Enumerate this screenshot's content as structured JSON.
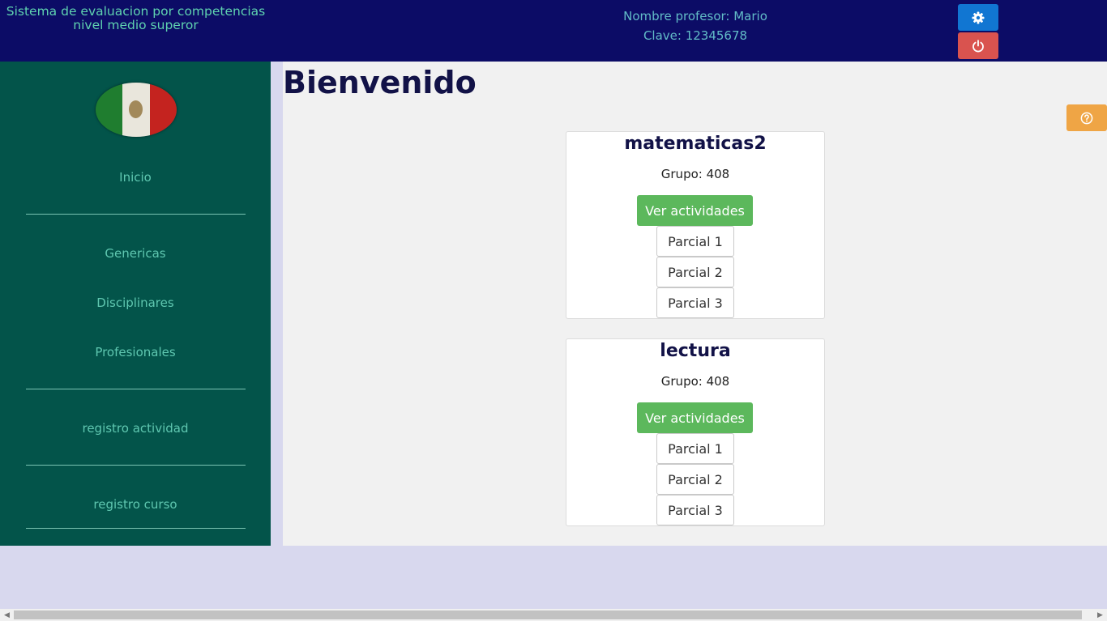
{
  "header": {
    "title_line1": "Sistema de evaluacion por competencias",
    "title_line2": "nivel medio superor",
    "profesor_label": "Nombre profesor: Mario",
    "clave_label": "Clave: 12345678",
    "settings_icon": "gear-icon",
    "logout_icon": "power-icon"
  },
  "sidebar": {
    "logo": "mexico-flag-logo",
    "items": [
      {
        "label": "Inicio"
      },
      {
        "label": "Genericas"
      },
      {
        "label": "Disciplinares"
      },
      {
        "label": "Profesionales"
      },
      {
        "label": "registro actividad"
      },
      {
        "label": "registro curso"
      }
    ]
  },
  "main": {
    "title": "Bienvenido",
    "help_icon": "question-circle-icon",
    "cards": [
      {
        "title": "matematicas2",
        "group": "Grupo: 408",
        "primary_button": "Ver actividades",
        "parciales": [
          "Parcial 1",
          "Parcial 2",
          "Parcial 3"
        ]
      },
      {
        "title": "lectura",
        "group": "Grupo: 408",
        "primary_button": "Ver actividades",
        "parciales": [
          "Parcial 1",
          "Parcial 2",
          "Parcial 3"
        ]
      }
    ]
  },
  "colors": {
    "header_bg": "#0c0c66",
    "sidebar_bg": "#03544a",
    "settings_btn": "#1176d2",
    "logout_btn": "#d9534f",
    "help_btn": "#efa545",
    "primary_green": "#5cb85c"
  }
}
